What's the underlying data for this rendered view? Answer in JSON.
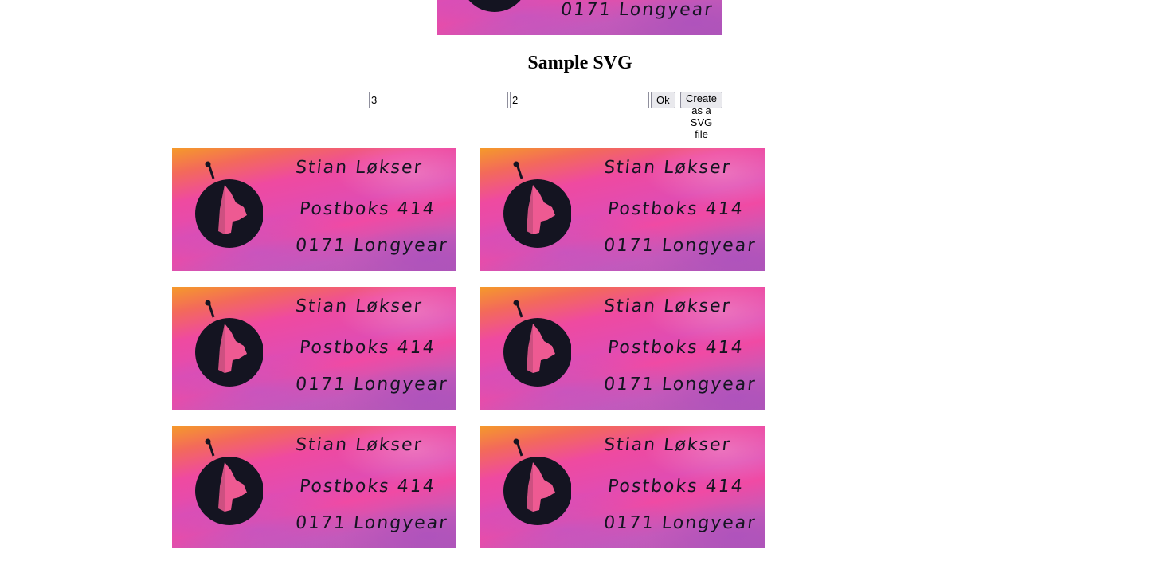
{
  "header": {
    "title": "Sample SVG"
  },
  "form": {
    "rows_value": "3",
    "cols_value": "2",
    "ok_label": "Ok",
    "create_label": "Create as a SVG file"
  },
  "label": {
    "line1": "Stian Løkser",
    "line2": "Postboks 414",
    "line3": "0171 Longyear"
  },
  "colors": {
    "logo_fill": "#141421",
    "gradient_orange": "#f59a2a",
    "gradient_pink": "#ef4aa0",
    "gradient_purple": "#b058b6"
  }
}
